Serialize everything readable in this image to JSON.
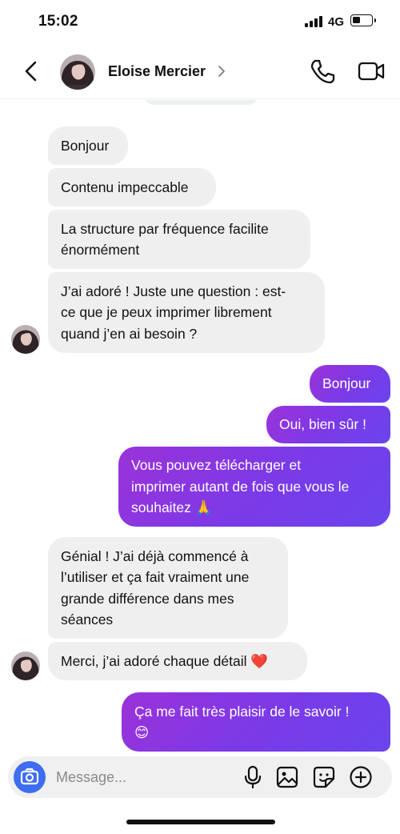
{
  "status_bar": {
    "time": "15:02",
    "network": "4G",
    "battery_level": 0.45
  },
  "header": {
    "contact_name": "Eloise Mercier",
    "icons": {
      "back": "chevron-left-icon",
      "call": "phone-icon",
      "video": "video-camera-icon",
      "chevron": "chevron-right-icon"
    }
  },
  "messages": [
    {
      "from": "them",
      "text": "Bonjour"
    },
    {
      "from": "them",
      "text": "Contenu impeccable"
    },
    {
      "from": "them",
      "text": "La structure par fréquence facilite\nénormément"
    },
    {
      "from": "them",
      "text": "J’ai adoré ! Juste une question : est-\nce que je peux imprimer librement\nquand j’en ai besoin ?"
    },
    {
      "from": "me",
      "text": "Bonjour"
    },
    {
      "from": "me",
      "text": "Oui, bien sûr !"
    },
    {
      "from": "me",
      "text": "Vous pouvez télécharger et\nimprimer autant de fois que vous le\nsouhaitez 🙏"
    },
    {
      "from": "them",
      "text": "Génial ! J’ai déjà commencé à\nl’utiliser et ça fait vraiment une\ngrande différence dans mes\nséances"
    },
    {
      "from": "them",
      "text": "Merci, j’ai adoré chaque détail ❤️"
    },
    {
      "from": "me",
      "text": "Ça me fait très plaisir de le savoir !\n😊"
    }
  ],
  "composer": {
    "placeholder": "Message...",
    "icons": [
      "camera-icon",
      "microphone-icon",
      "image-icon",
      "sticker-icon",
      "plus-circle-icon"
    ]
  },
  "colors": {
    "incoming_bubble": "#efefef",
    "outgoing_start": "#9b32d9",
    "outgoing_end": "#6a45ec",
    "camera_button": "#3d6df0"
  }
}
